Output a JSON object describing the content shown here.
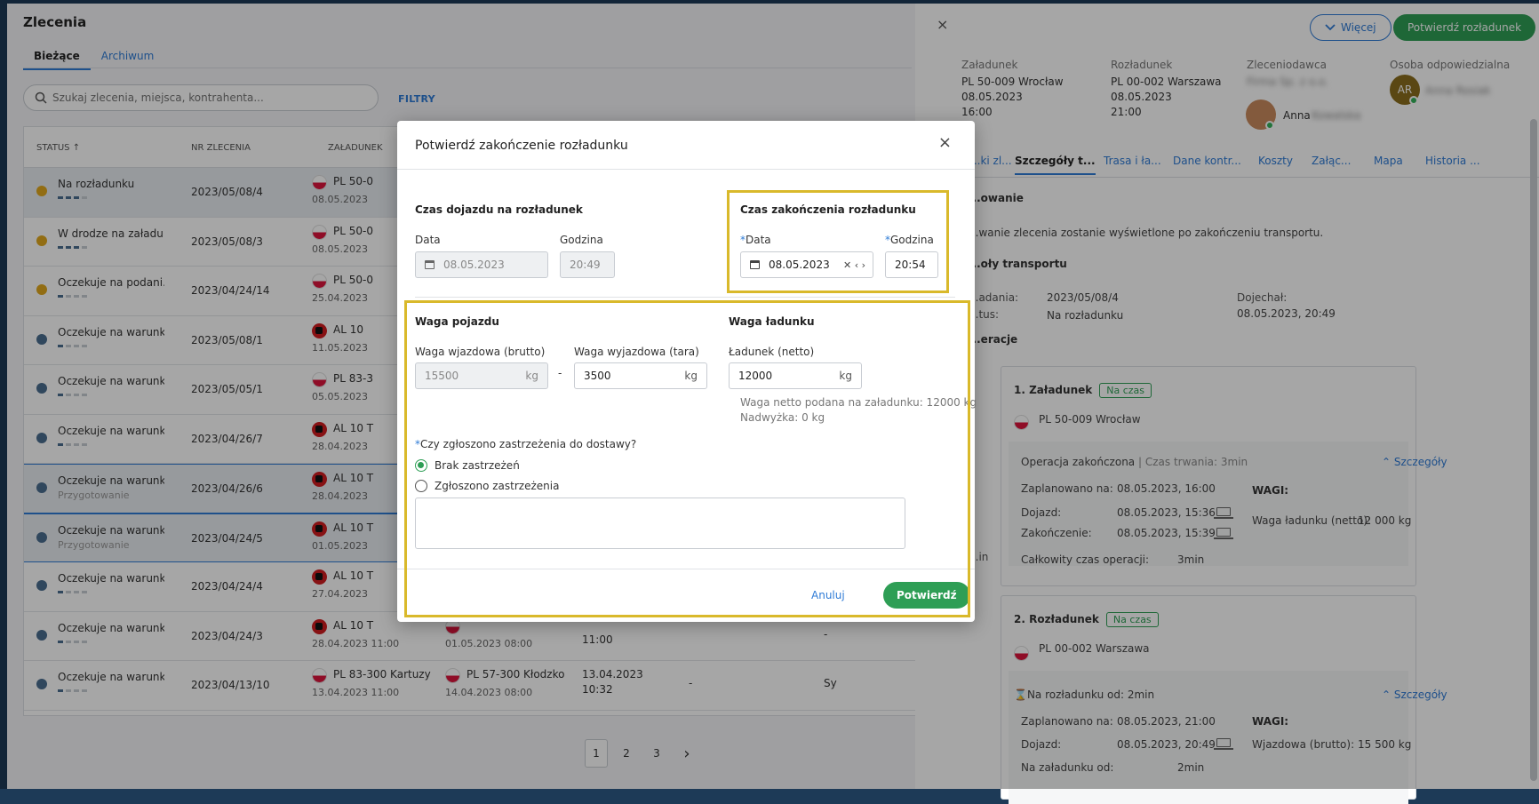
{
  "page": {
    "title": "Zlecenia",
    "tabs": [
      "Bieżące",
      "Archiwum"
    ],
    "search_placeholder": "Szukaj zlecenia, miejsca, kontrahenta...",
    "filters_label": "FILTRY"
  },
  "table": {
    "headers": [
      "STATUS ↑",
      "NR ZLECENIA",
      "ZAŁADUNEK"
    ],
    "rows": [
      {
        "status": "Na rozładunku",
        "sub": "",
        "nr": "2023/05/08/4",
        "load": "PL 50-0",
        "load_date": "08.05.2023"
      },
      {
        "status": "W drodze na załadu...",
        "sub": "",
        "nr": "2023/05/08/3",
        "load": "PL 50-0",
        "load_date": "08.05.2023"
      },
      {
        "status": "Oczekuje na podani...",
        "sub": "",
        "nr": "2023/04/24/14",
        "load": "PL 50-0",
        "load_date": "25.04.2023"
      },
      {
        "status": "Oczekuje na warunki",
        "sub": "",
        "nr": "2023/05/08/1",
        "load": "AL 10",
        "load_date": "11.05.2023"
      },
      {
        "status": "Oczekuje na warunki",
        "sub": "",
        "nr": "2023/05/05/1",
        "load": "PL 83-3",
        "load_date": "05.05.2023"
      },
      {
        "status": "Oczekuje na warunki",
        "sub": "",
        "nr": "2023/04/26/7",
        "load": "AL 10 T",
        "load_date": "28.04.2023"
      },
      {
        "status": "Oczekuje na warunki",
        "sub": "Przygotowanie",
        "nr": "2023/04/26/6",
        "load": "AL 10 T",
        "load_date": "28.04.2023"
      },
      {
        "status": "Oczekuje na warunki",
        "sub": "Przygotowanie",
        "nr": "2023/04/24/5",
        "load": "AL 10 T",
        "load_date": "01.05.2023"
      },
      {
        "status": "Oczekuje na warunki",
        "sub": "",
        "nr": "2023/04/24/4",
        "load": "AL 10 T",
        "load_date": "27.04.2023"
      },
      {
        "status": "Oczekuje na warunki",
        "sub": "",
        "nr": "2023/04/24/3",
        "load": "AL 10 T",
        "load_date": "28.04.2023 11:00"
      },
      {
        "status": "Oczekuje na warunki",
        "sub": "",
        "nr": "2023/04/13/10",
        "load": "PL 83-300 Kartuzy",
        "load_date": "13.04.2023 11:00"
      }
    ],
    "extra_row9": {
      "unload_date": "01.05.2023 08:00",
      "time": "11:00",
      "dash": "-"
    },
    "extra_row10": {
      "unload": "PL 57-300 Kłodzko",
      "unload_date": "14.04.2023 08:00",
      "date": "13.04.2023",
      "time": "10:32",
      "dash": "-",
      "tail": "Sy"
    }
  },
  "pager": {
    "pages": [
      "1",
      "2",
      "3"
    ],
    "next": "›"
  },
  "panel": {
    "close": "×",
    "more_label": "Więcej",
    "confirm_label": "Potwierdź rozładunek",
    "loading_label": "Załadunek",
    "loading_lines": [
      "PL 50-009 Wrocław",
      "08.05.2023",
      "16:00"
    ],
    "unloading_label": "Rozładunek",
    "unloading_lines": [
      "PL 00-002 Warszawa",
      "08.05.2023",
      "21:00"
    ],
    "client_label": "Zleceniodawca",
    "client_blur": "Firma Sp. z o.o.",
    "person_label": "Osoba odpowiedzialna",
    "person_initials": "AR",
    "person_blur": "Anna Rosiak",
    "driver_name": "Anna",
    "driver_blur": "Kowalska",
    "tabs": [
      "...ki zl...",
      "Szczegóły t...",
      "Trasa i ła...",
      "Dane kontr...",
      "Koszty",
      "Załąc...",
      "Mapa",
      "Historia ..."
    ],
    "rating_head": "...owanie",
    "rating_text": "...wanie zlecenia zostanie wyświetlone po zakończeniu transportu.",
    "transport_head": "...oły transportu",
    "nr_label": "...adania:",
    "nr_value": "2023/05/08/4",
    "status_label": "...tus:",
    "status_value": "Na rozładunku",
    "arrived_label": "Dojechał:",
    "arrived_value": "08.05.2023, 20:49",
    "ops_head": "...eracje",
    "side_in": "...in",
    "op1": {
      "title": "1. Załadunek",
      "badge": "Na czas",
      "place": "PL 50-009 Wrocław",
      "state": "Operacja zakończona",
      "duration": "| Czas trwania: 3min",
      "details": "Szczegóły",
      "planned_label": "Zaplanowano na:",
      "planned": "08.05.2023, 16:00",
      "arrive_label": "Dojazd:",
      "arrive": "08.05.2023, 15:36",
      "end_label": "Zakończenie:",
      "end": "08.05.2023, 15:39",
      "total_label": "Całkowity czas operacji:",
      "total": "3min",
      "weights_head": "WAGI:",
      "weight_label": "Waga ładunku (netto):",
      "weight": "12 000 kg"
    },
    "op2": {
      "title": "2. Rozładunek",
      "badge": "Na czas",
      "place": "PL 00-002 Warszawa",
      "state": "Na rozładunku od: 2min",
      "details": "Szczegóły",
      "planned_label": "Zaplanowano na:",
      "planned": "08.05.2023, 21:00",
      "arrive_label": "Dojazd:",
      "arrive": "08.05.2023, 20:49",
      "since_label": "Na załadunku od:",
      "since": "2min",
      "weights_head": "WAGI:",
      "weight_label": "Wjazdowa (brutto):",
      "weight": "15 500 kg"
    }
  },
  "modal": {
    "title": "Potwierdź zakończenie rozładunku",
    "close": "×",
    "arrival_head": "Czas dojazdu na rozładunek",
    "arrival_date_label": "Data",
    "arrival_date": "08.05.2023",
    "arrival_time_label": "Godzina",
    "arrival_time": "20:49",
    "end_head": "Czas zakończenia rozładunku",
    "end_date_label": "Data",
    "end_date": "08.05.2023",
    "end_time_label": "Godzina",
    "end_time": "20:54",
    "req_mark": "*",
    "vehicle_head": "Waga pojazdu",
    "in_label": "Waga wjazdowa (brutto)",
    "in_value": "15500",
    "out_label": "Waga wyjazdowa (tara)",
    "out_value": "3500",
    "minus": "-",
    "unit": "kg",
    "cargo_head": "Waga ładunku",
    "net_label": "Ładunek (netto)",
    "net_value": "12000",
    "net_info1": "Waga netto podana na załadunku: 12000 kg",
    "net_info2": "Nadwyżka: 0 kg",
    "question": "Czy zgłoszono zastrzeżenia do dostawy?",
    "opt1": "Brak zastrzeżeń",
    "opt2": "Zgłoszono zastrzeżenia",
    "cancel": "Anuluj",
    "ok": "Potwierdź"
  },
  "colors": {
    "accent": "#2f7bd6",
    "green": "#2e9e55",
    "highlight": "#d9b92b"
  }
}
